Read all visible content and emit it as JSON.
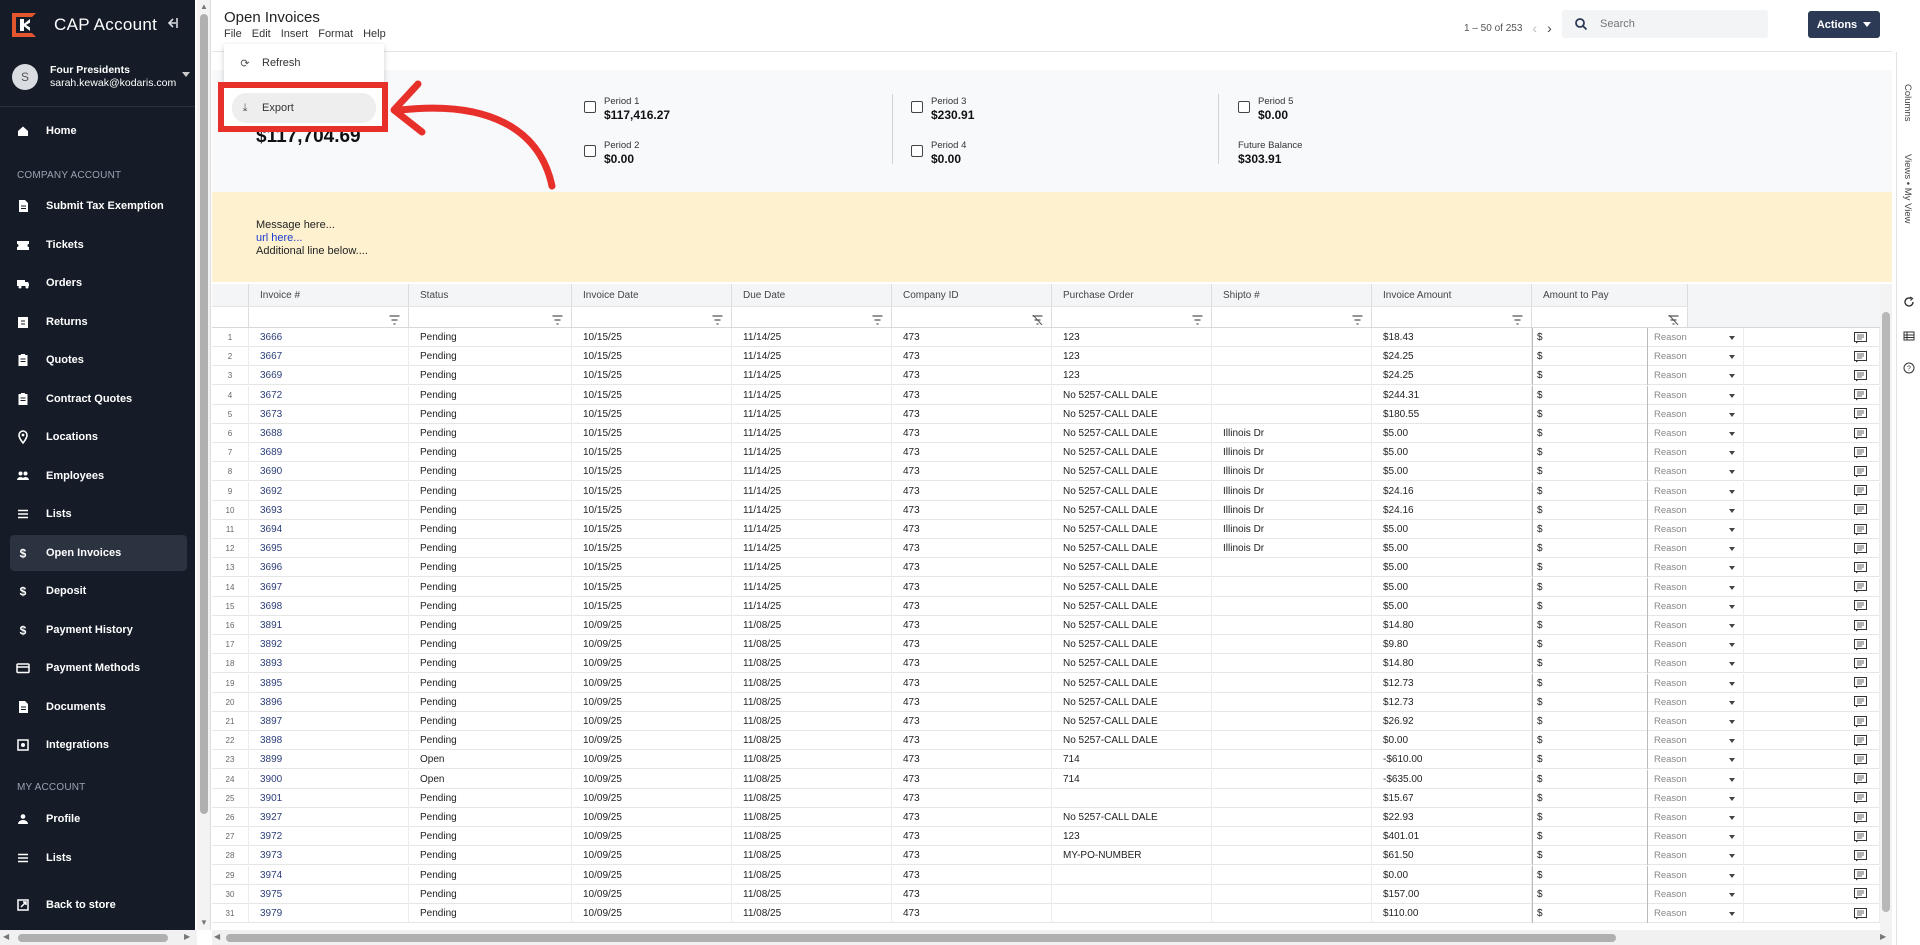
{
  "app": {
    "title": "CAP Account"
  },
  "user": {
    "avatar_letter": "S",
    "company": "Four Presidents",
    "email": "sarah.kewak@kodaris.com"
  },
  "nav": {
    "home": "Home",
    "section_company": "COMPANY ACCOUNT",
    "company_items": [
      "Submit Tax Exemption",
      "Tickets",
      "Orders",
      "Returns",
      "Quotes",
      "Contract Quotes",
      "Locations",
      "Employees",
      "Lists",
      "Open Invoices",
      "Deposit",
      "Payment History",
      "Payment Methods",
      "Documents",
      "Integrations"
    ],
    "company_icons": [
      "document-icon",
      "ticket-icon",
      "truck-icon",
      "return-icon",
      "clipboard-icon",
      "clipboard-icon",
      "location-pin-icon",
      "people-icon",
      "list-icon",
      "dollar-icon",
      "dollar-icon",
      "dollar-icon",
      "credit-card-icon",
      "document-icon",
      "integrations-icon"
    ],
    "active_item": "Open Invoices",
    "section_my": "MY ACCOUNT",
    "my_items": [
      "Profile",
      "Lists"
    ],
    "back": "Back to store"
  },
  "header": {
    "page_title": "Open Invoices",
    "menu": [
      "File",
      "Edit",
      "Insert",
      "Format",
      "Help"
    ],
    "pager": "1 – 50 of 253",
    "search_placeholder": "Search",
    "actions_label": "Actions"
  },
  "file_menu": {
    "items": [
      "Refresh",
      "Export"
    ],
    "hovered": "Export"
  },
  "summary": {
    "total_balance": "$117,704.69",
    "periods": [
      {
        "label": "Period 1",
        "value": "$117,416.27",
        "checkbox": true
      },
      {
        "label": "Period 2",
        "value": "$0.00",
        "checkbox": true
      },
      {
        "label": "Period 3",
        "value": "$230.91",
        "checkbox": true
      },
      {
        "label": "Period 4",
        "value": "$0.00",
        "checkbox": true
      },
      {
        "label": "Period 5",
        "value": "$0.00",
        "checkbox": true
      },
      {
        "label": "Future Balance",
        "value": "$303.91",
        "checkbox": false
      }
    ]
  },
  "message": {
    "line1": "Message here...",
    "link": "url here...",
    "line3": "Additional line below...."
  },
  "grid": {
    "columns": [
      "Invoice #",
      "Status",
      "Invoice Date",
      "Due Date",
      "Company ID",
      "Purchase Order",
      "Shipto #",
      "Invoice Amount",
      "Amount to Pay"
    ],
    "pay_prefix": "$",
    "reason_placeholder": "Reason",
    "rows": [
      [
        "3666",
        "Pending",
        "10/15/25",
        "11/14/25",
        "473",
        "123",
        "",
        "$18.43"
      ],
      [
        "3667",
        "Pending",
        "10/15/25",
        "11/14/25",
        "473",
        "123",
        "",
        "$24.25"
      ],
      [
        "3669",
        "Pending",
        "10/15/25",
        "11/14/25",
        "473",
        "123",
        "",
        "$24.25"
      ],
      [
        "3672",
        "Pending",
        "10/15/25",
        "11/14/25",
        "473",
        "No 5257-CALL DALE",
        "",
        "$244.31"
      ],
      [
        "3673",
        "Pending",
        "10/15/25",
        "11/14/25",
        "473",
        "No 5257-CALL DALE",
        "",
        "$180.55"
      ],
      [
        "3688",
        "Pending",
        "10/15/25",
        "11/14/25",
        "473",
        "No 5257-CALL DALE",
        "Illinois Dr",
        "$5.00"
      ],
      [
        "3689",
        "Pending",
        "10/15/25",
        "11/14/25",
        "473",
        "No 5257-CALL DALE",
        "Illinois Dr",
        "$5.00"
      ],
      [
        "3690",
        "Pending",
        "10/15/25",
        "11/14/25",
        "473",
        "No 5257-CALL DALE",
        "Illinois Dr",
        "$5.00"
      ],
      [
        "3692",
        "Pending",
        "10/15/25",
        "11/14/25",
        "473",
        "No 5257-CALL DALE",
        "Illinois Dr",
        "$24.16"
      ],
      [
        "3693",
        "Pending",
        "10/15/25",
        "11/14/25",
        "473",
        "No 5257-CALL DALE",
        "Illinois Dr",
        "$24.16"
      ],
      [
        "3694",
        "Pending",
        "10/15/25",
        "11/14/25",
        "473",
        "No 5257-CALL DALE",
        "Illinois Dr",
        "$5.00"
      ],
      [
        "3695",
        "Pending",
        "10/15/25",
        "11/14/25",
        "473",
        "No 5257-CALL DALE",
        "Illinois Dr",
        "$5.00"
      ],
      [
        "3696",
        "Pending",
        "10/15/25",
        "11/14/25",
        "473",
        "No 5257-CALL DALE",
        "",
        "$5.00"
      ],
      [
        "3697",
        "Pending",
        "10/15/25",
        "11/14/25",
        "473",
        "No 5257-CALL DALE",
        "",
        "$5.00"
      ],
      [
        "3698",
        "Pending",
        "10/15/25",
        "11/14/25",
        "473",
        "No 5257-CALL DALE",
        "",
        "$5.00"
      ],
      [
        "3891",
        "Pending",
        "10/09/25",
        "11/08/25",
        "473",
        "No 5257-CALL DALE",
        "",
        "$14.80"
      ],
      [
        "3892",
        "Pending",
        "10/09/25",
        "11/08/25",
        "473",
        "No 5257-CALL DALE",
        "",
        "$9.80"
      ],
      [
        "3893",
        "Pending",
        "10/09/25",
        "11/08/25",
        "473",
        "No 5257-CALL DALE",
        "",
        "$14.80"
      ],
      [
        "3895",
        "Pending",
        "10/09/25",
        "11/08/25",
        "473",
        "No 5257-CALL DALE",
        "",
        "$12.73"
      ],
      [
        "3896",
        "Pending",
        "10/09/25",
        "11/08/25",
        "473",
        "No 5257-CALL DALE",
        "",
        "$12.73"
      ],
      [
        "3897",
        "Pending",
        "10/09/25",
        "11/08/25",
        "473",
        "No 5257-CALL DALE",
        "",
        "$26.92"
      ],
      [
        "3898",
        "Pending",
        "10/09/25",
        "11/08/25",
        "473",
        "No 5257-CALL DALE",
        "",
        "$0.00"
      ],
      [
        "3899",
        "Open",
        "10/09/25",
        "11/08/25",
        "473",
        "714",
        "",
        "-$610.00"
      ],
      [
        "3900",
        "Open",
        "10/09/25",
        "11/08/25",
        "473",
        "714",
        "",
        "-$635.00"
      ],
      [
        "3901",
        "Pending",
        "10/09/25",
        "11/08/25",
        "473",
        "",
        "",
        "$15.67"
      ],
      [
        "3927",
        "Pending",
        "10/09/25",
        "11/08/25",
        "473",
        "No 5257-CALL DALE",
        "",
        "$22.93"
      ],
      [
        "3972",
        "Pending",
        "10/09/25",
        "11/08/25",
        "473",
        "123",
        "",
        "$401.01"
      ],
      [
        "3973",
        "Pending",
        "10/09/25",
        "11/08/25",
        "473",
        "MY-PO-NUMBER",
        "",
        "$61.50"
      ],
      [
        "3974",
        "Pending",
        "10/09/25",
        "11/08/25",
        "473",
        "",
        "",
        "$0.00"
      ],
      [
        "3975",
        "Pending",
        "10/09/25",
        "11/08/25",
        "473",
        "",
        "",
        "$157.00"
      ],
      [
        "3979",
        "Pending",
        "10/09/25",
        "11/08/25",
        "473",
        "",
        "",
        "$110.00"
      ]
    ]
  },
  "right_rail": {
    "columns_label": "Columns",
    "views_label": "Views • My View"
  },
  "colors": {
    "sidebar_bg": "#151c27",
    "active_nav": "#2b3240",
    "actions_bg": "#2d3a56",
    "message_bg": "#fdf1cf",
    "highlight": "#e8302a"
  }
}
